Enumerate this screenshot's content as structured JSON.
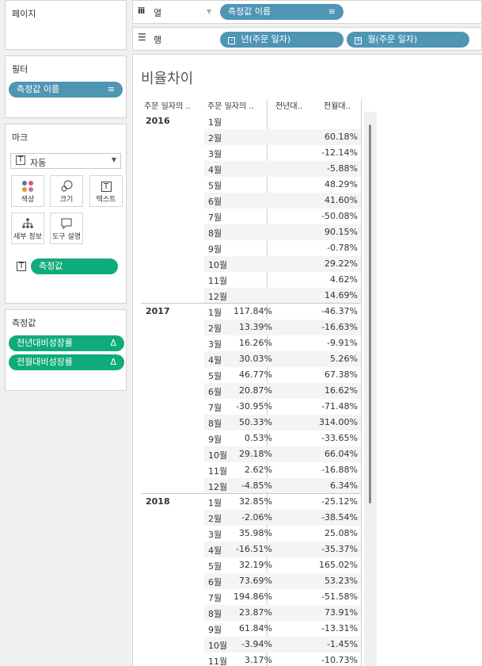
{
  "cards": {
    "pages": {
      "title": "페이지"
    },
    "filters": {
      "title": "필터",
      "pill": "측정값 이름"
    },
    "marks": {
      "title": "마크",
      "dropdown": "자동",
      "buttons": {
        "color": "색상",
        "size": "크기",
        "text": "텍스트",
        "detail": "세부 정보",
        "tooltip": "도구 설명"
      },
      "pill": "측정값"
    },
    "measures": {
      "title": "측정값",
      "pills": [
        "전년대비성장률",
        "전월대비성장률"
      ]
    }
  },
  "shelves": {
    "columns": {
      "label": "열",
      "pill": "측정값 이름"
    },
    "rows": {
      "label": "행",
      "pills": [
        "년(주문 일자)",
        "월(주문 일자)"
      ]
    }
  },
  "view": {
    "title": "비율차이",
    "headers": [
      "주문 일자의 ..",
      "주문 일자의 ..",
      "전년대..",
      "전월대.."
    ],
    "groups": [
      {
        "year": "2016",
        "rows": [
          {
            "m": "1월",
            "yoy": "",
            "mom": ""
          },
          {
            "m": "2월",
            "yoy": "",
            "mom": "60.18%"
          },
          {
            "m": "3월",
            "yoy": "",
            "mom": "-12.14%"
          },
          {
            "m": "4월",
            "yoy": "",
            "mom": "-5.88%"
          },
          {
            "m": "5월",
            "yoy": "",
            "mom": "48.29%"
          },
          {
            "m": "6월",
            "yoy": "",
            "mom": "41.60%"
          },
          {
            "m": "7월",
            "yoy": "",
            "mom": "-50.08%"
          },
          {
            "m": "8월",
            "yoy": "",
            "mom": "90.15%"
          },
          {
            "m": "9월",
            "yoy": "",
            "mom": "-0.78%"
          },
          {
            "m": "10월",
            "yoy": "",
            "mom": "29.22%"
          },
          {
            "m": "11월",
            "yoy": "",
            "mom": "4.62%"
          },
          {
            "m": "12월",
            "yoy": "",
            "mom": "14.69%"
          }
        ]
      },
      {
        "year": "2017",
        "rows": [
          {
            "m": "1월",
            "yoy": "117.84%",
            "mom": "-46.37%"
          },
          {
            "m": "2월",
            "yoy": "13.39%",
            "mom": "-16.63%"
          },
          {
            "m": "3월",
            "yoy": "16.26%",
            "mom": "-9.91%"
          },
          {
            "m": "4월",
            "yoy": "30.03%",
            "mom": "5.26%"
          },
          {
            "m": "5월",
            "yoy": "46.77%",
            "mom": "67.38%"
          },
          {
            "m": "6월",
            "yoy": "20.87%",
            "mom": "16.62%"
          },
          {
            "m": "7월",
            "yoy": "-30.95%",
            "mom": "-71.48%"
          },
          {
            "m": "8월",
            "yoy": "50.33%",
            "mom": "314.00%"
          },
          {
            "m": "9월",
            "yoy": "0.53%",
            "mom": "-33.65%"
          },
          {
            "m": "10월",
            "yoy": "29.18%",
            "mom": "66.04%"
          },
          {
            "m": "11월",
            "yoy": "2.62%",
            "mom": "-16.88%"
          },
          {
            "m": "12월",
            "yoy": "-4.85%",
            "mom": "6.34%"
          }
        ]
      },
      {
        "year": "2018",
        "rows": [
          {
            "m": "1월",
            "yoy": "32.85%",
            "mom": "-25.12%"
          },
          {
            "m": "2월",
            "yoy": "-2.06%",
            "mom": "-38.54%"
          },
          {
            "m": "3월",
            "yoy": "35.98%",
            "mom": "25.08%"
          },
          {
            "m": "4월",
            "yoy": "-16.51%",
            "mom": "-35.37%"
          },
          {
            "m": "5월",
            "yoy": "32.19%",
            "mom": "165.02%"
          },
          {
            "m": "6월",
            "yoy": "73.69%",
            "mom": "53.23%"
          },
          {
            "m": "7월",
            "yoy": "194.86%",
            "mom": "-51.58%"
          },
          {
            "m": "8월",
            "yoy": "23.87%",
            "mom": "73.91%"
          },
          {
            "m": "9월",
            "yoy": "61.84%",
            "mom": "-13.31%"
          },
          {
            "m": "10월",
            "yoy": "-3.94%",
            "mom": "-1.45%"
          },
          {
            "m": "11월",
            "yoy": "3.17%",
            "mom": "-10.73%"
          }
        ]
      }
    ]
  }
}
